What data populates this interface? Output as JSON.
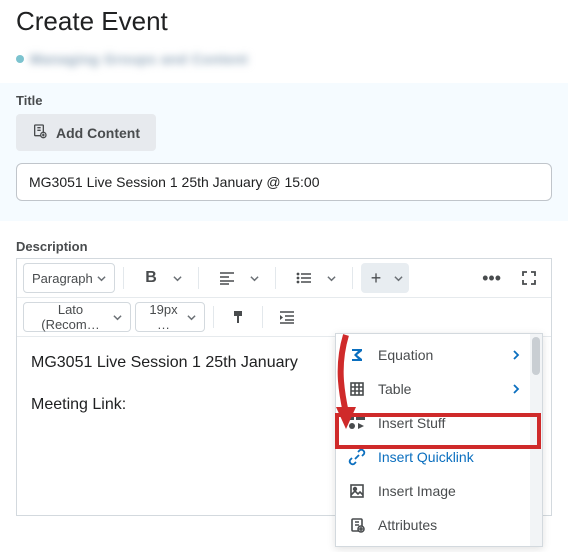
{
  "page": {
    "title": "Create Event",
    "breadcrumb_blur": "Managing Groups and Content"
  },
  "title_field": {
    "label": "Title",
    "add_content": "Add Content",
    "value": "MG3051 Live Session 1 25th January @ 15:00"
  },
  "description_field": {
    "label": "Description"
  },
  "toolbar": {
    "paragraph": "Paragraph",
    "font_family": "Lato (Recom…",
    "font_size": "19px …"
  },
  "editor_content": {
    "line1": "MG3051 Live Session 1 25th January ",
    "line2": "Meeting Link:"
  },
  "insert_menu": {
    "items": [
      {
        "icon": "sigma-icon",
        "label": "Equation",
        "submenu": true
      },
      {
        "icon": "table-icon",
        "label": "Table",
        "submenu": true
      },
      {
        "icon": "stuff-icon",
        "label": "Insert Stuff",
        "submenu": false
      },
      {
        "icon": "link-icon",
        "label": "Insert Quicklink",
        "submenu": false,
        "highlight": true
      },
      {
        "icon": "image-icon",
        "label": "Insert Image",
        "submenu": false
      },
      {
        "icon": "attributes-icon",
        "label": "Attributes",
        "submenu": false
      }
    ]
  }
}
